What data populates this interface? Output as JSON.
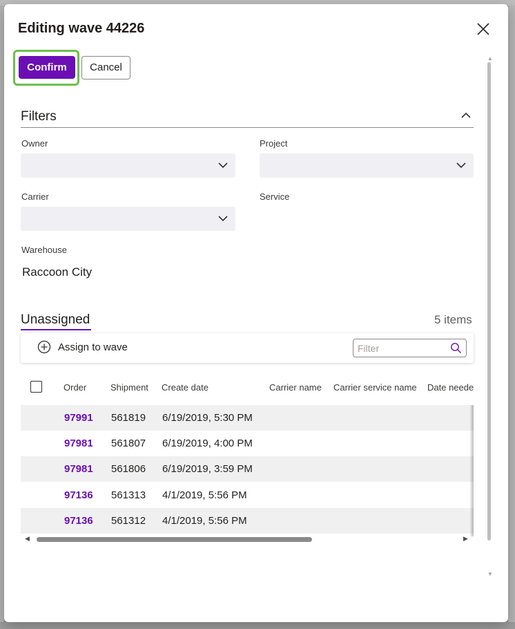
{
  "dialog": {
    "title": "Editing wave 44226",
    "close_label": "Close",
    "confirm_label": "Confirm",
    "cancel_label": "Cancel"
  },
  "filters": {
    "title": "Filters",
    "owner": {
      "label": "Owner",
      "value": ""
    },
    "project": {
      "label": "Project",
      "value": ""
    },
    "carrier": {
      "label": "Carrier",
      "value": ""
    },
    "service": {
      "label": "Service"
    },
    "warehouse": {
      "label": "Warehouse",
      "value": "Raccoon City"
    }
  },
  "unassigned": {
    "tab_label": "Unassigned",
    "items_count": "5 items",
    "assign_label": "Assign to wave",
    "filter_placeholder": "Filter",
    "columns": [
      "Order",
      "Shipment",
      "Create date",
      "Carrier name",
      "Carrier service name",
      "Date neede"
    ],
    "rows": [
      {
        "order": "97991",
        "shipment": "561819",
        "create_date": "6/19/2019, 5:30 PM"
      },
      {
        "order": "97981",
        "shipment": "561807",
        "create_date": "6/19/2019, 4:00 PM"
      },
      {
        "order": "97981",
        "shipment": "561806",
        "create_date": "6/19/2019, 3:59 PM"
      },
      {
        "order": "97136",
        "shipment": "561313",
        "create_date": "4/1/2019, 5:56 PM"
      },
      {
        "order": "97136",
        "shipment": "561312",
        "create_date": "4/1/2019, 5:56 PM"
      }
    ]
  },
  "colors": {
    "accent": "#6b0fb4",
    "highlight_outline": "#6cc04a",
    "select_bg": "#f0eff4",
    "row_shade": "#f0f0f0"
  },
  "icons": {
    "close": "close-icon",
    "collapse": "chevron-up-icon",
    "dropdown": "chevron-down-icon",
    "add": "add-circle-icon",
    "search": "search-icon"
  }
}
